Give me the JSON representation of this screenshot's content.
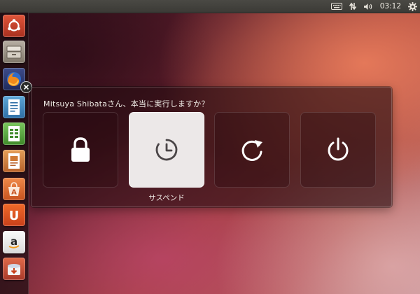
{
  "panel": {
    "clock": "03:12",
    "indicators": [
      "keyboard-icon",
      "network-icon",
      "volume-icon",
      "settings-gear-icon"
    ]
  },
  "launcher": {
    "items": [
      {
        "name": "ubuntu-dash-icon"
      },
      {
        "name": "files-icon"
      },
      {
        "name": "firefox-icon"
      },
      {
        "name": "writer-icon"
      },
      {
        "name": "calc-icon"
      },
      {
        "name": "impress-icon"
      },
      {
        "name": "software-center-icon"
      },
      {
        "name": "ubuntu-one-icon"
      },
      {
        "name": "amazon-icon"
      },
      {
        "name": "update-manager-icon"
      }
    ]
  },
  "dialog": {
    "title": "Mitsuya Shibataさん、本当に実行しますか？",
    "actions": [
      {
        "id": "lock",
        "icon": "lock-icon",
        "label": ""
      },
      {
        "id": "suspend",
        "icon": "suspend-icon",
        "label": "サスペンド",
        "selected": true
      },
      {
        "id": "restart",
        "icon": "restart-icon",
        "label": ""
      },
      {
        "id": "shutdown",
        "icon": "power-icon",
        "label": ""
      }
    ]
  },
  "colors": {
    "panel_bg": "#3b3a36",
    "selected_tile": "#ece8e8",
    "selected_icon": "#4a4547",
    "icon_white": "#ffffff"
  }
}
